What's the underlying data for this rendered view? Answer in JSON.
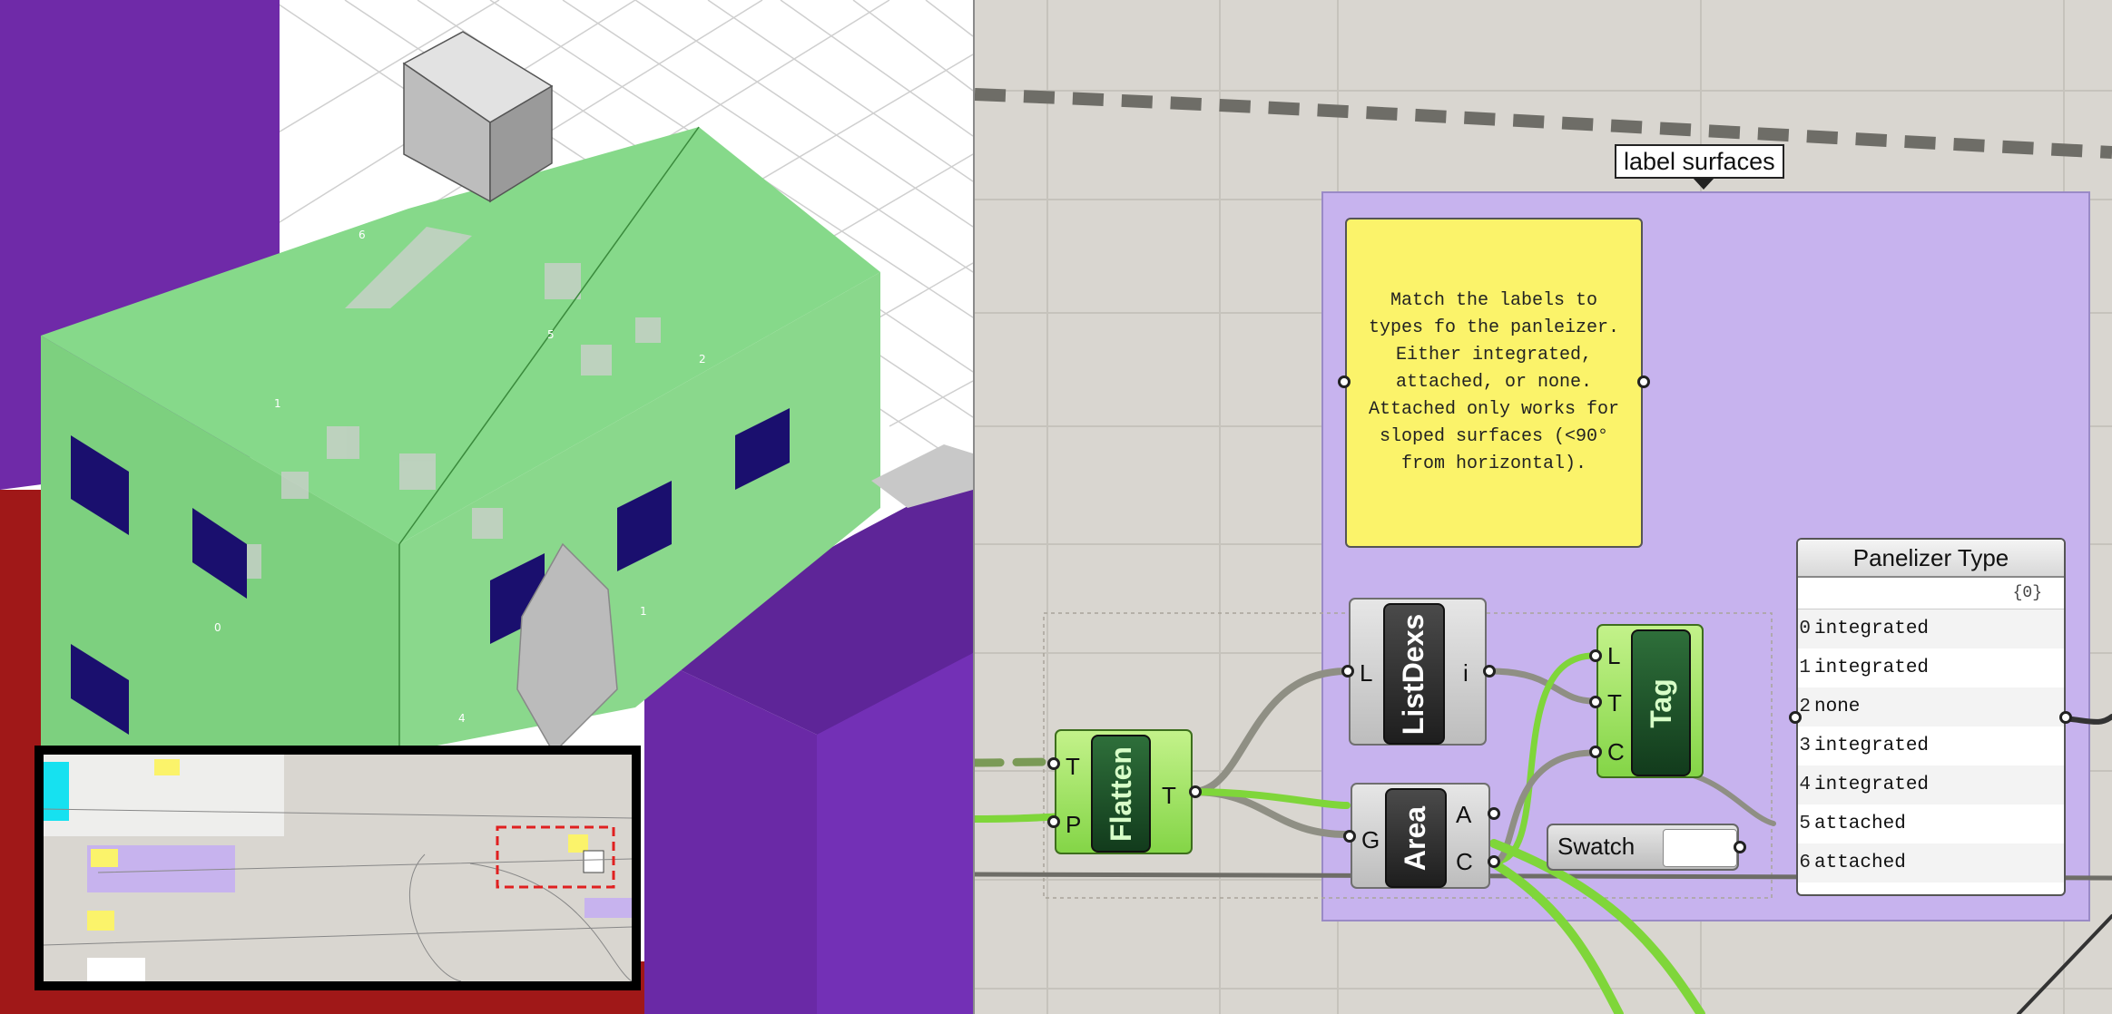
{
  "viewport": {
    "face_labels": [
      "6",
      "5",
      "2",
      "1",
      "0",
      "1",
      "4"
    ],
    "colors": {
      "green": "#86d98a",
      "purple": "#6f2aa8",
      "red": "#a01818",
      "window": "#1a0f6e",
      "grey": "#c9c9c9"
    }
  },
  "canvas": {
    "group_title": "label surfaces",
    "note_text": "Match the labels to\ntypes fo the panleizer.\nEither integrated,\nattached, or none.\nAttached only works for\nsloped surfaces (<90°\nfrom horizontal).",
    "flatten": {
      "name": "Flatten",
      "inputs": [
        "T",
        "P"
      ],
      "outputs": [
        "T"
      ]
    },
    "listdexs": {
      "name": "ListDexs",
      "inputs": [
        "L"
      ],
      "outputs": [
        "i"
      ]
    },
    "tag": {
      "name": "Tag",
      "inputs": [
        "L",
        "T",
        "C"
      ]
    },
    "area": {
      "name": "Area",
      "inputs": [
        "G"
      ],
      "outputs": [
        "A",
        "C"
      ]
    },
    "swatch": {
      "label": "Swatch"
    },
    "panel": {
      "title": "Panelizer Type",
      "path": "{0}",
      "rows": [
        {
          "index": "0",
          "value": "integrated"
        },
        {
          "index": "1",
          "value": "integrated"
        },
        {
          "index": "2",
          "value": "none"
        },
        {
          "index": "3",
          "value": "integrated"
        },
        {
          "index": "4",
          "value": "integrated"
        },
        {
          "index": "5",
          "value": "attached"
        },
        {
          "index": "6",
          "value": "attached"
        }
      ]
    },
    "colors": {
      "group_bg": "#c7b3ee",
      "wire_green": "#7fd63a",
      "wire_grey": "#7c7c74",
      "note_bg": "#fbf36a"
    }
  }
}
